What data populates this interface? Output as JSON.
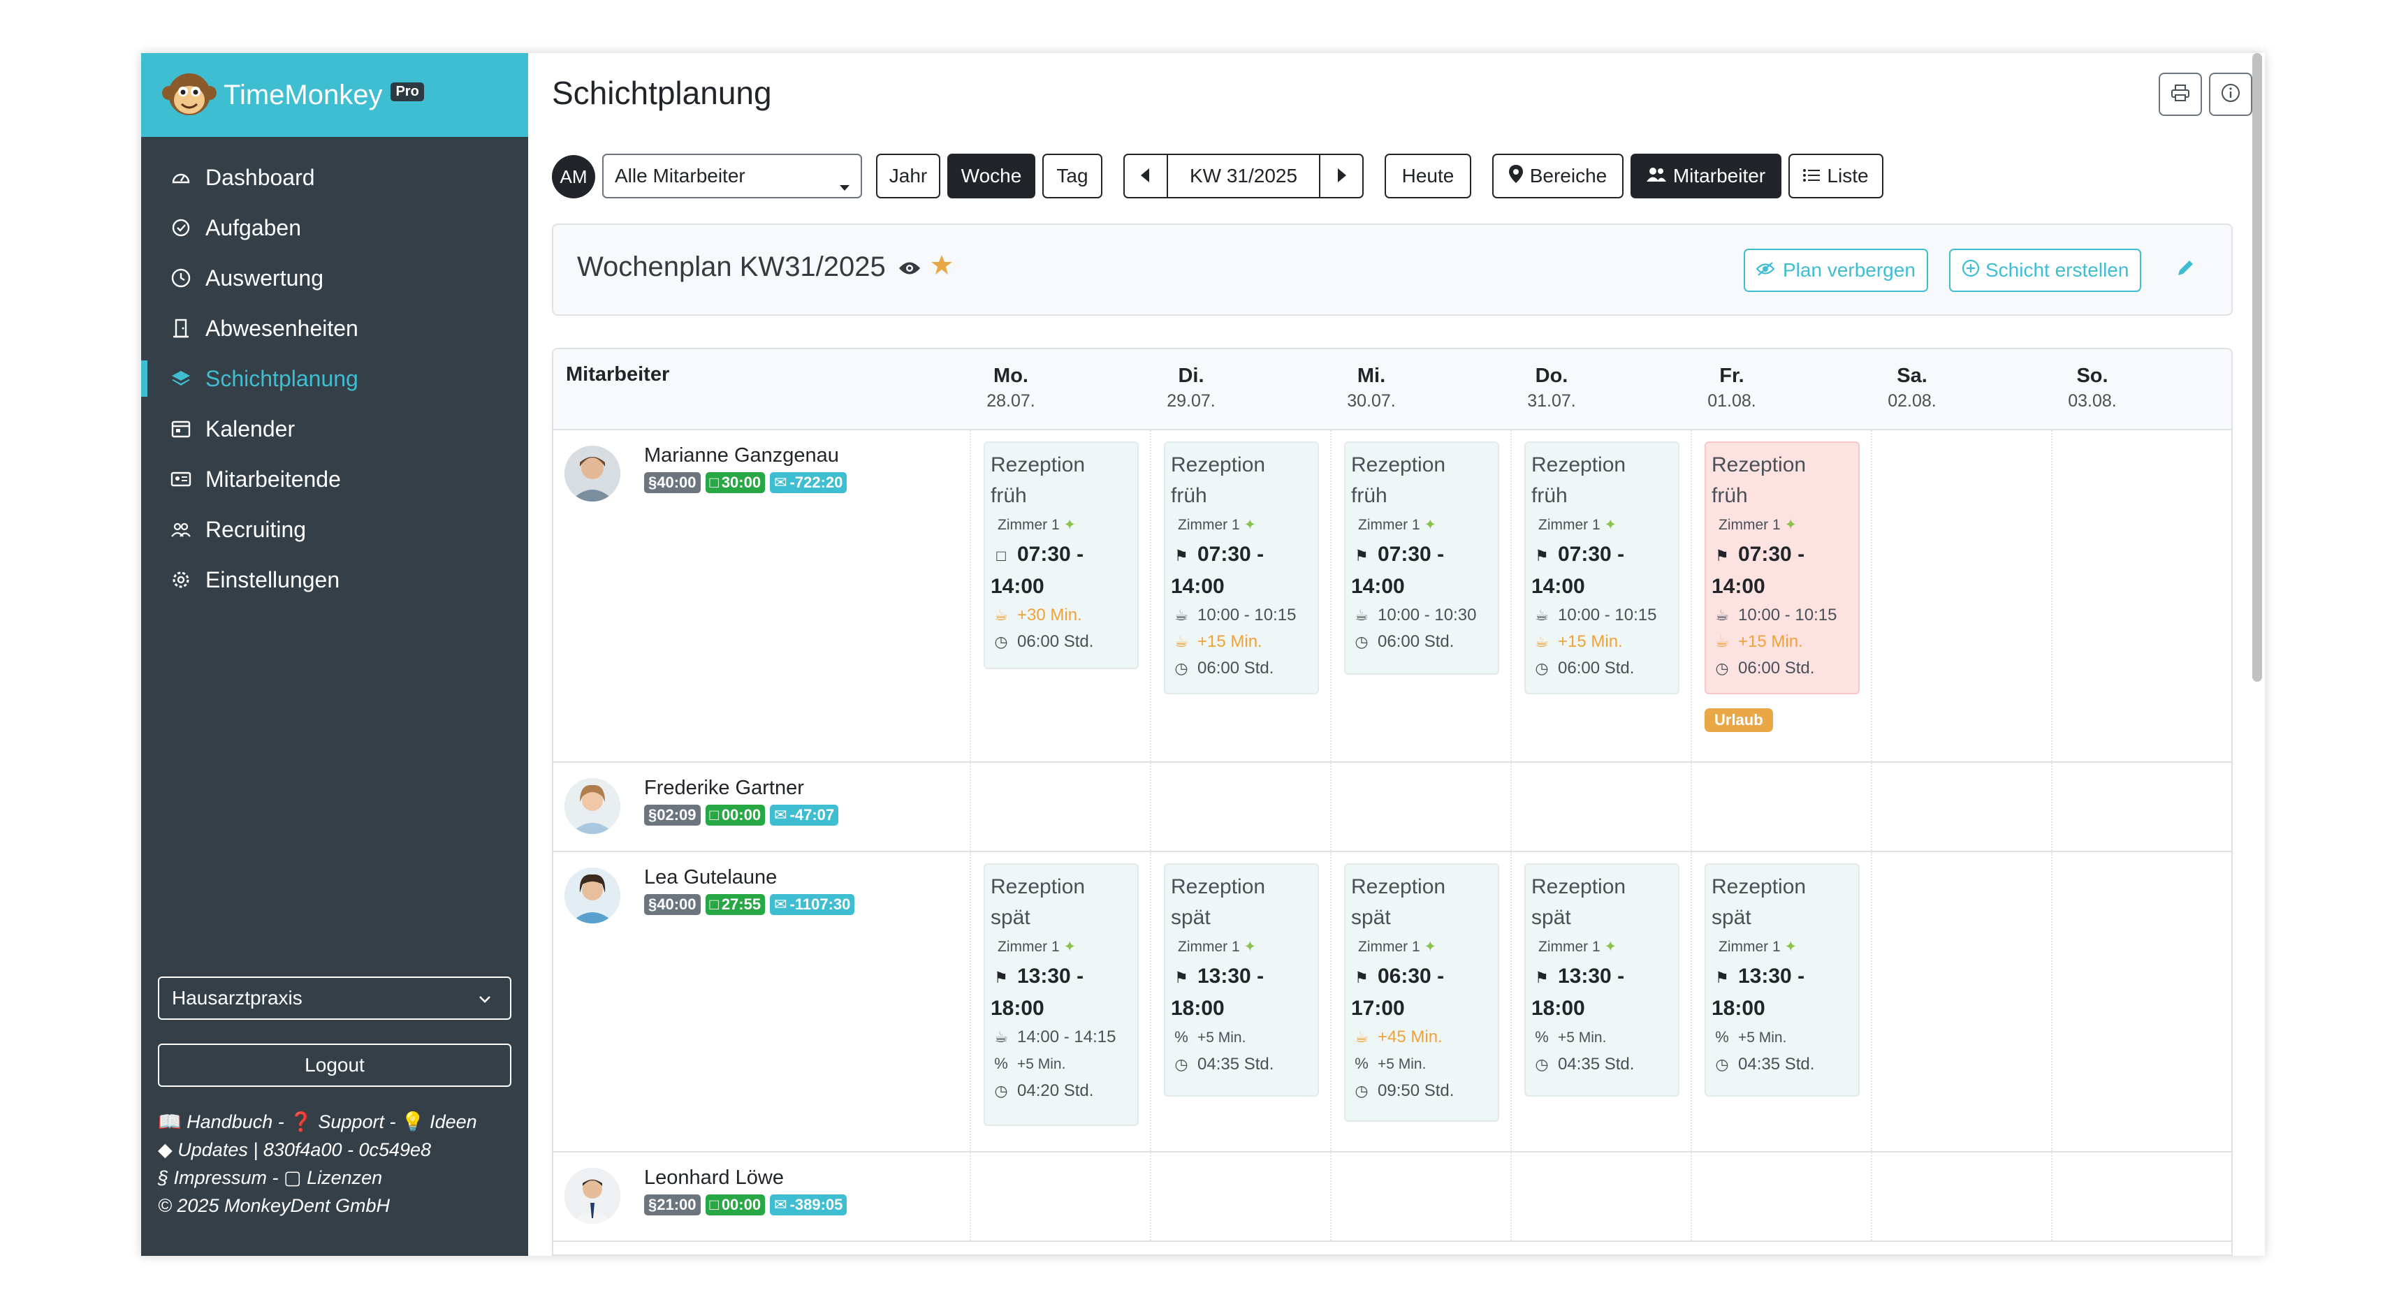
{
  "app": {
    "name": "TimeMonkey",
    "badge": "Pro"
  },
  "sidebar": {
    "items": [
      {
        "label": "Dashboard",
        "icon": "gauge-icon"
      },
      {
        "label": "Aufgaben",
        "icon": "check-circle-icon"
      },
      {
        "label": "Auswertung",
        "icon": "clock-icon"
      },
      {
        "label": "Abwesenheiten",
        "icon": "door-icon"
      },
      {
        "label": "Schichtplanung",
        "icon": "layers-icon"
      },
      {
        "label": "Kalender",
        "icon": "calendar-icon"
      },
      {
        "label": "Mitarbeitende",
        "icon": "id-card-icon"
      },
      {
        "label": "Recruiting",
        "icon": "people-icon"
      },
      {
        "label": "Einstellungen",
        "icon": "gear-icon"
      }
    ],
    "active": "Schichtplanung",
    "practice_select": "Hausarztpraxis",
    "logout": "Logout",
    "footer": {
      "handbuch": "Handbuch",
      "support": "Support",
      "ideen": "Ideen",
      "updates": "Updates | 830f4a00 - 0c549e8",
      "impressum": "§ Impressum",
      "lizenzen": "Lizenzen",
      "copyright": "© 2025 MonkeyDent GmbH"
    }
  },
  "main": {
    "title": "Schichtplanung",
    "toolbar": {
      "user_initials": "AM",
      "employee_select": "Alle Mitarbeiter",
      "jahr": "Jahr",
      "woche": "Woche",
      "tag": "Tag",
      "week": "KW 31/2025",
      "heute": "Heute",
      "bereiche": "Bereiche",
      "mitarbeiter": "Mitarbeiter",
      "liste": "Liste"
    },
    "plan": {
      "title": "Wochenplan KW31/2025",
      "hide_button": "Plan verbergen",
      "create_button": "Schicht erstellen"
    },
    "table": {
      "employee_header": "Mitarbeiter",
      "days": [
        {
          "name": "Mo.",
          "date": "28.07."
        },
        {
          "name": "Di.",
          "date": "29.07."
        },
        {
          "name": "Mi.",
          "date": "30.07."
        },
        {
          "name": "Do.",
          "date": "31.07."
        },
        {
          "name": "Fr.",
          "date": "01.08."
        },
        {
          "name": "Sa.",
          "date": "02.08."
        },
        {
          "name": "So.",
          "date": "03.08."
        }
      ],
      "employees": [
        {
          "name": "Marianne Ganzgenau",
          "badges": [
            "§40:00",
            "30:00",
            "-722:20"
          ],
          "shifts": [
            {
              "title1": "Rezeption",
              "title2": "früh",
              "room": "Zimmer 1",
              "time1": "07:30 -",
              "time2": "14:00",
              "extra": "+30 Min.",
              "hours": "06:00 Std."
            },
            {
              "title1": "Rezeption",
              "title2": "früh",
              "room": "Zimmer 1",
              "time1": "07:30 -",
              "time2": "14:00",
              "pause": "10:00 - 10:15",
              "extra": "+15 Min.",
              "hours": "06:00 Std."
            },
            {
              "title1": "Rezeption",
              "title2": "früh",
              "room": "Zimmer 1",
              "time1": "07:30 -",
              "time2": "14:00",
              "pause": "10:00 - 10:30",
              "hours": "06:00 Std."
            },
            {
              "title1": "Rezeption",
              "title2": "früh",
              "room": "Zimmer 1",
              "time1": "07:30 -",
              "time2": "14:00",
              "pause": "10:00 - 10:15",
              "extra": "+15 Min.",
              "hours": "06:00 Std."
            },
            {
              "title1": "Rezeption",
              "title2": "früh",
              "room": "Zimmer 1",
              "time1": "07:30 -",
              "time2": "14:00",
              "pause": "10:00 - 10:15",
              "extra": "+15 Min.",
              "hours": "06:00 Std.",
              "tag": "Urlaub"
            }
          ]
        },
        {
          "name": "Frederike Gartner",
          "badges": [
            "§02:09",
            "00:00",
            "-47:07"
          ]
        },
        {
          "name": "Lea Gutelaune",
          "badges": [
            "§40:00",
            "27:55",
            "-1107:30"
          ],
          "shifts": [
            {
              "title1": "Rezeption",
              "title2": "spät",
              "room": "Zimmer 1",
              "time1": "13:30 -",
              "time2": "18:00",
              "pause": "14:00 - 14:15",
              "plus": "+5 Min.",
              "hours": "04:20 Std."
            },
            {
              "title1": "Rezeption",
              "title2": "spät",
              "room": "Zimmer 1",
              "time1": "13:30 -",
              "time2": "18:00",
              "plus": "+5 Min.",
              "hours": "04:35 Std."
            },
            {
              "title1": "Rezeption",
              "title2": "spät",
              "room": "Zimmer 1",
              "time1": "06:30 -",
              "time2": "17:00",
              "extra": "+45 Min.",
              "plus": "+5 Min.",
              "hours": "09:50 Std."
            },
            {
              "title1": "Rezeption",
              "title2": "spät",
              "room": "Zimmer 1",
              "time1": "13:30 -",
              "time2": "18:00",
              "plus": "+5 Min.",
              "hours": "04:35 Std."
            },
            {
              "title1": "Rezeption",
              "title2": "spät",
              "room": "Zimmer 1",
              "time1": "13:30 -",
              "time2": "18:00",
              "plus": "+5 Min.",
              "hours": "04:35 Std."
            }
          ]
        },
        {
          "name": "Leonhard Löwe",
          "badges": [
            "§21:00",
            "00:00",
            "-389:05"
          ]
        }
      ]
    }
  },
  "colors": {
    "accent": "#3fbdd1",
    "sidebar": "#343f47",
    "vacation": "#e9a845",
    "green": "#28a745"
  }
}
